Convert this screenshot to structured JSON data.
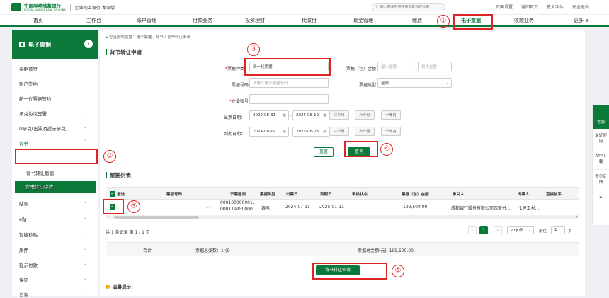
{
  "header": {
    "bank_name": "中国邮政储蓄银行",
    "bank_name_en": "POSTAL SAVINGS BANK OF CHINA",
    "brand": "企业网上银行-专业版",
    "search_placeholder": "输入菜单名称快速匹配相应功能",
    "links": [
      "页面设置",
      "返回首页",
      "放大字体",
      "安全退出"
    ]
  },
  "nav": [
    "首页",
    "工作台",
    "账户管理",
    "付款业务",
    "投资理财",
    "代收付",
    "现金管理",
    "缴费",
    "电子票据",
    "收款业务",
    "更多"
  ],
  "sidebar": {
    "title": "电子票据",
    "items": [
      "票据首页",
      "账户签约",
      "新一代票据签约",
      "承兑协议签署",
      "U承兑(出票及提示承兑)",
      "背书",
      "背书转让申请",
      "背书转让撤销",
      "背书转让签收",
      "贴现",
      "e贴",
      "智能秒贴",
      "质押",
      "提示付款",
      "保证",
      "追索"
    ]
  },
  "breadcrumb": "您当前的位置：电子票据 / 背书 / 背书转让申请",
  "form": {
    "section_title": "背书转让申请",
    "bill_type_label": "票据种类：",
    "bill_type_value": "新一代票据",
    "amount_label": "票据（包）金额",
    "amount_min_ph": "最小金额",
    "amount_max_ph": "最大金额",
    "bill_no_label": "票据号码",
    "bill_no_ph": "请输入电子票据号码",
    "bill_kind_label": "票据类型",
    "bill_kind_value": "全部",
    "account_label": "企业账号",
    "issue_date_label": "出票日期：",
    "issue_from": "2022-08-31",
    "issue_to": "2024-08-19",
    "due_date_label": "到期日期：",
    "due_from": "2024-08-19",
    "due_to": "2026-08-08",
    "quick": [
      "三个月",
      "六个月",
      "一年内"
    ],
    "reset": "重置",
    "query": "查询"
  },
  "list": {
    "section_title": "票据列表",
    "columns": [
      "全选",
      "票据号码",
      "子票区间",
      "票据类型",
      "出票日",
      "到期日",
      "审核状态",
      "票据（包）金额",
      "承兑人",
      "出票人",
      "直接前手"
    ],
    "row": {
      "sub_range": "000100000001,000119950000",
      "bill_no": "...",
      "type": "银承",
      "issue_date": "2024-07-11",
      "due_date": "2025-01-11",
      "amount": "199,500.00",
      "acceptor": "成都银行股份有限公司西安分...",
      "drawer": "\"1建工材..."
    },
    "record_info": "共 1 条记录  第 1 / 1 页",
    "page": "1",
    "per_page": "20条/页",
    "goto_label": "前往",
    "goto_value": "1",
    "page_unit": "页",
    "total_label": "合计",
    "total_count": "票据总张数：1 张",
    "total_amount": "票据总金额(元): 199,500.00",
    "submit": "背书转让申请"
  },
  "tips": "温馨提示：",
  "float_panel": [
    "客服",
    "最近使用",
    "APP下载",
    "意见反馈",
    "»"
  ],
  "annotations": [
    "①",
    "②",
    "③",
    "④",
    "⑤",
    "⑥"
  ],
  "colors": {
    "primary": "#0a7a3b",
    "annotation": "#e02424"
  }
}
